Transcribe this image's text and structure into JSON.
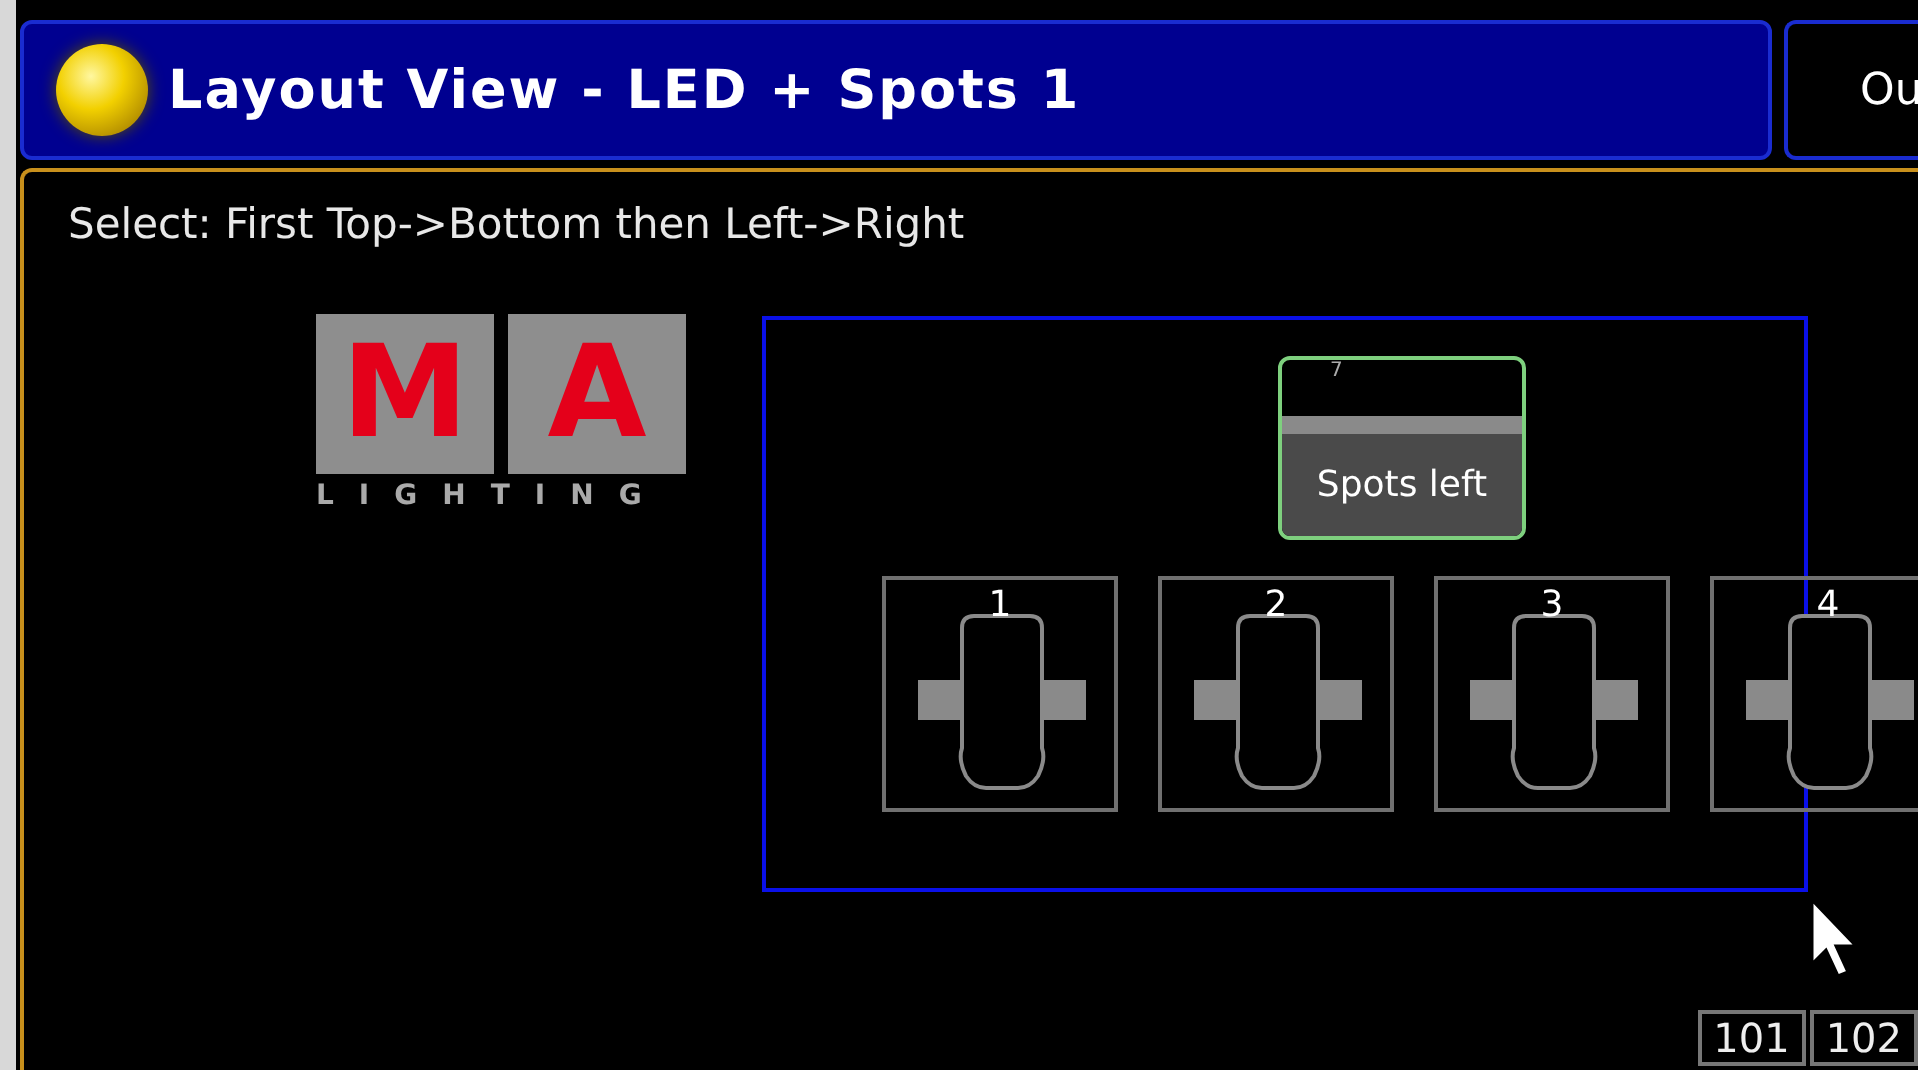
{
  "window": {
    "title": "Layout View - LED + Spots 1"
  },
  "side_tab": {
    "label": "Ou"
  },
  "instruction": "Select: First Top->Bottom then Left->Right",
  "logo": {
    "letters": [
      "M",
      "A"
    ],
    "tagline": "LIGHTING"
  },
  "group": {
    "number": "7",
    "name": "Spots left"
  },
  "fixtures": [
    {
      "label": "1"
    },
    {
      "label": "2"
    },
    {
      "label": "3"
    },
    {
      "label": "4"
    }
  ],
  "cells": [
    "101",
    "102"
  ]
}
